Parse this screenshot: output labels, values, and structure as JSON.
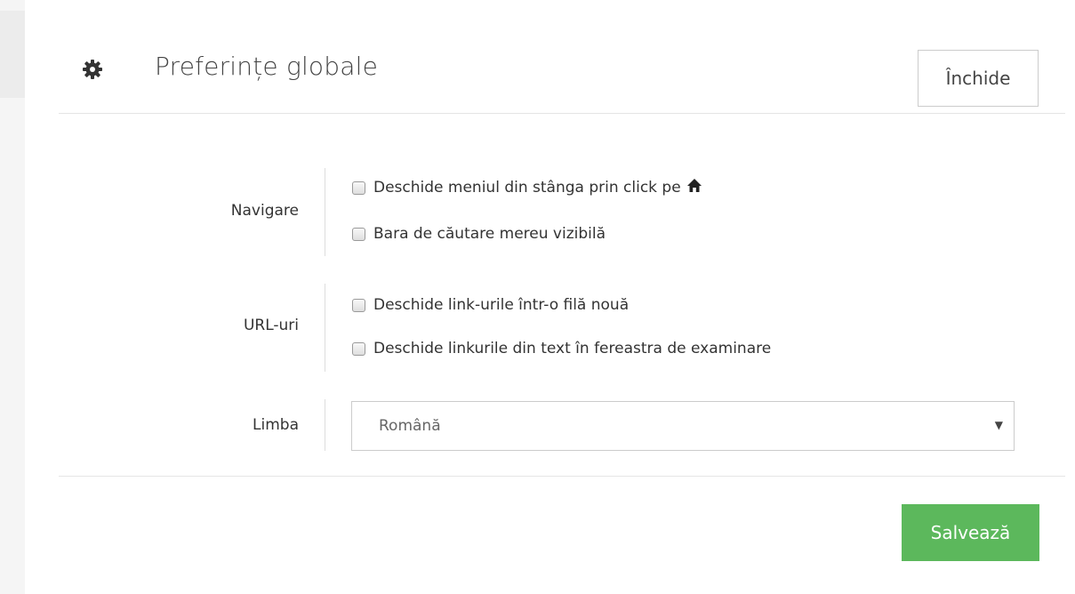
{
  "header": {
    "icon": "gear-icon",
    "title": "Preferințe globale",
    "close_label": "Închide"
  },
  "sections": {
    "navigation": {
      "label": "Navigare",
      "options": [
        {
          "label": "Deschide meniul din stânga prin click pe",
          "checked": false,
          "trailing_icon": "home-icon"
        },
        {
          "label": "Bara de căutare mereu vizibilă",
          "checked": false
        }
      ]
    },
    "urls": {
      "label": "URL-uri",
      "options": [
        {
          "label": "Deschide link-urile într-o filă nouă",
          "checked": false
        },
        {
          "label": "Deschide linkurile din text în fereastra de examinare",
          "checked": false
        }
      ]
    },
    "language": {
      "label": "Limba",
      "selected": "Română"
    }
  },
  "footer": {
    "save_label": "Salvează"
  },
  "colors": {
    "save_button": "#5cb85c",
    "title_text": "#444444",
    "divider": "#e5e5e5"
  }
}
